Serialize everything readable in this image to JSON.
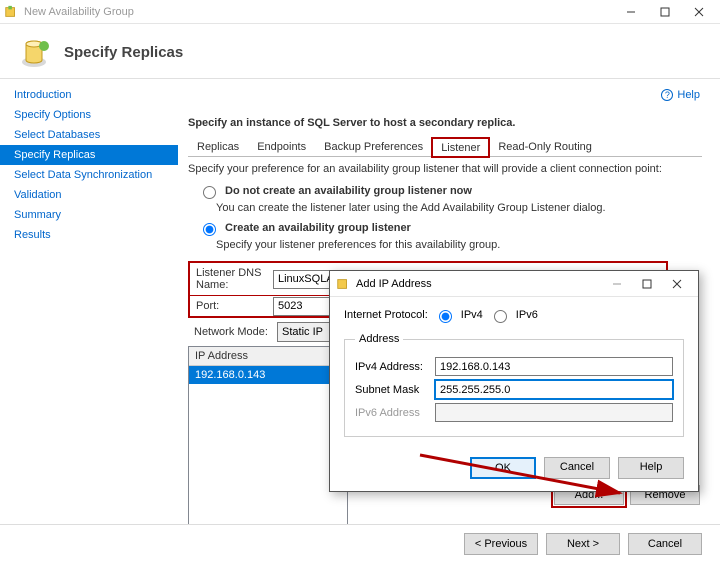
{
  "window": {
    "title": "New Availability Group"
  },
  "header": {
    "title": "Specify Replicas"
  },
  "sidebar": {
    "items": [
      {
        "label": "Introduction"
      },
      {
        "label": "Specify Options"
      },
      {
        "label": "Select Databases"
      },
      {
        "label": "Specify Replicas"
      },
      {
        "label": "Select Data Synchronization"
      },
      {
        "label": "Validation"
      },
      {
        "label": "Summary"
      },
      {
        "label": "Results"
      }
    ],
    "selected_index": 3
  },
  "help_label": "Help",
  "main": {
    "instruction": "Specify an instance of SQL Server to host a secondary replica.",
    "tabs": [
      "Replicas",
      "Endpoints",
      "Backup Preferences",
      "Listener",
      "Read-Only Routing"
    ],
    "active_tab_index": 3,
    "pref_note": "Specify your preference for an availability group listener that will provide a client connection point:",
    "option_no_create": "Do not create an availability group listener now",
    "option_no_create_sub": "You can create the listener later using the Add Availability Group Listener dialog.",
    "option_create": "Create an availability group listener",
    "option_create_sub": "Specify your listener preferences for this availability group.",
    "selected_option": "create",
    "form": {
      "dns_label": "Listener DNS Name:",
      "dns_value": "LinuxSQLAG",
      "port_label": "Port:",
      "port_value": "5023",
      "netmode_label": "Network Mode:",
      "netmode_value": "Static IP"
    },
    "iptable": {
      "header": "IP Address",
      "rows": [
        "192.168.0.143"
      ]
    },
    "add_label": "Add...",
    "remove_label": "Remove"
  },
  "footer": {
    "previous": "< Previous",
    "next": "Next >",
    "cancel": "Cancel"
  },
  "dialog": {
    "title": "Add IP Address",
    "protocol_label": "Internet Protocol:",
    "ipv4_label": "IPv4",
    "ipv6_label": "IPv6",
    "protocol_selected": "ipv4",
    "fieldset_label": "Address",
    "ipv4_addr_label": "IPv4 Address:",
    "ipv4_addr_value": "192.168.0.143",
    "subnet_label": "Subnet Mask",
    "subnet_value": "255.255.255.0",
    "ipv6_addr_label": "IPv6 Address",
    "ipv6_addr_value": "",
    "ok": "OK",
    "cancel": "Cancel",
    "help": "Help"
  }
}
